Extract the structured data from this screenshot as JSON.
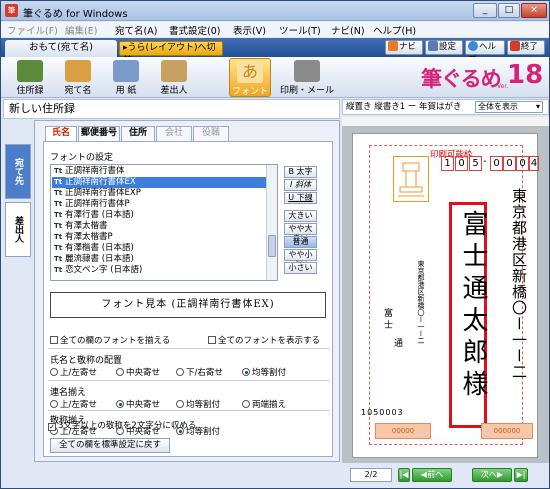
{
  "window": {
    "title": "筆ぐるめ for Windows",
    "minimize": "_",
    "maximize": "□",
    "close": "×"
  },
  "menu": [
    {
      "label": "ファイル(F)",
      "disabled": false
    },
    {
      "label": "編集(E)",
      "disabled": true
    },
    {
      "label": "宛て名(A)",
      "disabled": false
    },
    {
      "label": "書式設定(0)",
      "disabled": false
    },
    {
      "label": "表示(V)",
      "disabled": false
    },
    {
      "label": "ツール(T)",
      "disabled": false
    },
    {
      "label": "ナビ(N)",
      "disabled": false
    },
    {
      "label": "ヘルプ(H)",
      "disabled": false
    }
  ],
  "modebar": {
    "front_tab": "おもて(宛て名)",
    "back_tab": "▸うら(レイアウト)へ切替",
    "navi": "ナビ",
    "settings": "設定",
    "help": "ヘルプ",
    "exit": "終了"
  },
  "tools": [
    {
      "label": "住所録",
      "color": "#5a8a3a"
    },
    {
      "label": "宛て名",
      "color": "#d8a040"
    },
    {
      "label": "用 紙",
      "color": "#7a9ac8"
    },
    {
      "label": "差出人",
      "color": "#c8a060"
    },
    {
      "label": "フォント",
      "color": "#f0c060"
    },
    {
      "label": "印刷・メール",
      "color": "#8a8a8a"
    }
  ],
  "logo": {
    "text": "筆ぐるめ",
    "version_num": "18",
    "ver": "Ver."
  },
  "left": {
    "title": "新しい住所録",
    "side_tab_to": "宛て先",
    "side_tab_from": "差出人",
    "tabs": [
      {
        "label": "氏名",
        "selected": true,
        "disabled": false
      },
      {
        "label": "郵便番号",
        "selected": false,
        "disabled": false
      },
      {
        "label": "住所",
        "selected": false,
        "disabled": false
      },
      {
        "label": "会社",
        "selected": false,
        "disabled": true
      },
      {
        "label": "役職",
        "selected": false,
        "disabled": true
      }
    ],
    "font_settings_label": "フォントの設定",
    "fonts": [
      {
        "name": "正調祥南行書体",
        "selected": false
      },
      {
        "name": "正調祥南行書体EX",
        "selected": true
      },
      {
        "name": "正調祥南行書体EXP",
        "selected": false
      },
      {
        "name": "正調祥南行書体P",
        "selected": false
      },
      {
        "name": "有澤行書 (日本語)",
        "selected": false
      },
      {
        "name": "有澤太楷書",
        "selected": false
      },
      {
        "name": "有澤太楷書P",
        "selected": false
      },
      {
        "name": "有澤楷書 (日本語)",
        "selected": false
      },
      {
        "name": "麗流隷書 (日本語)",
        "selected": false
      },
      {
        "name": "恋文ペン字 (日本語)",
        "selected": false
      }
    ],
    "style_buttons": [
      "B 太字",
      "I 斜体",
      "U 下線"
    ],
    "size_buttons": [
      {
        "label": "大きい",
        "selected": false
      },
      {
        "label": "やや大きい",
        "selected": false
      },
      {
        "label": "普通",
        "selected": true
      },
      {
        "label": "やや小さい",
        "selected": false
      },
      {
        "label": "小さい",
        "selected": false
      }
    ],
    "preview_text": "フォント見本 (正調祥南行書体EX)",
    "all_fonts_same": "全ての欄のフォントを揃える",
    "show_all_fonts": "全てのフォントを表示する",
    "layout_label": "氏名と敬称の配置",
    "layout_options": [
      {
        "label": "上/左寄せ",
        "on": false
      },
      {
        "label": "中央寄せ",
        "on": false
      },
      {
        "label": "下/右寄せ",
        "on": false
      },
      {
        "label": "均等割付",
        "on": true
      }
    ],
    "joint_label": "連名揃え",
    "joint_options": [
      {
        "label": "上/左寄せ",
        "on": false
      },
      {
        "label": "中央寄せ",
        "on": true
      },
      {
        "label": "均等割付",
        "on": false
      },
      {
        "label": "両端揃え",
        "on": false
      }
    ],
    "honorific_label": "敬称揃え",
    "honorific_options": [
      {
        "label": "上/左寄せ",
        "on": false
      },
      {
        "label": "中央寄せ",
        "on": false
      },
      {
        "label": "均等割付",
        "on": true
      }
    ],
    "limit_check": "3文字以上の敬称を2文字分に収める",
    "reset_button": "全ての欄を標準設定に戻す"
  },
  "right": {
    "header": "縦置き 縦書き1 ー 年賀はがき",
    "view_select": "全体を表示",
    "print_area": "印刷可能枠",
    "zip": [
      "1",
      "0",
      "5",
      "-",
      "0",
      "0",
      "0",
      "4"
    ],
    "address": "東京都港区新橋〇ー一ー二",
    "name": "富士通太郎様",
    "from_address": "東京都港区新橋〇ー一ー二",
    "from_name_1": "富士",
    "from_name_2": "通",
    "from_zip": "1050003",
    "lottery_1": "00000",
    "lottery_2": "000000",
    "page": "2/2",
    "prev": "前へ",
    "next": "次へ"
  }
}
